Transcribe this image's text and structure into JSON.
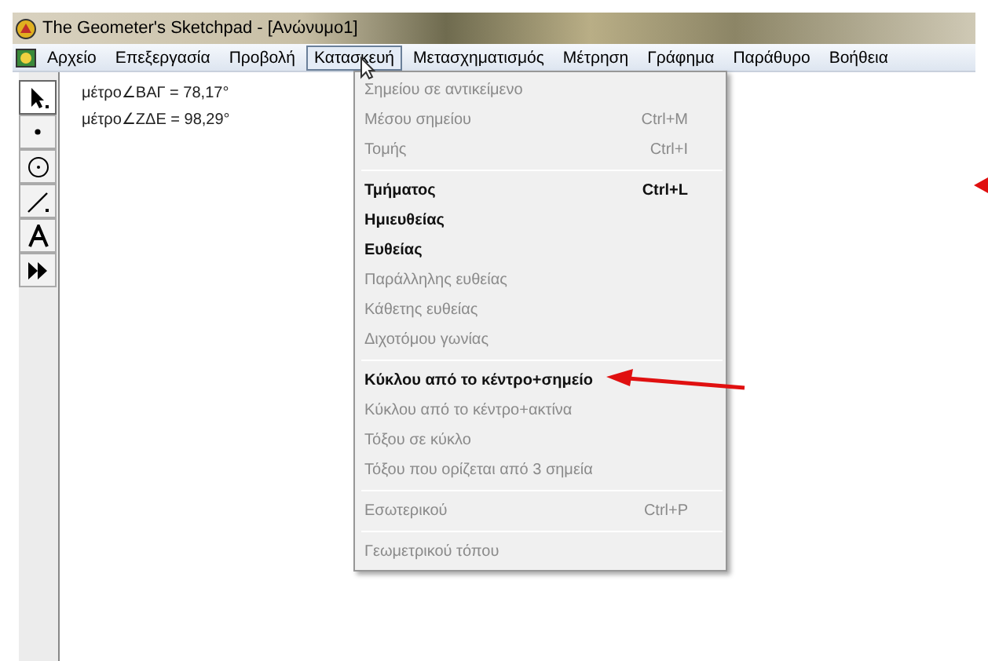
{
  "window": {
    "title": "The Geometer's Sketchpad - [Ανώνυμο1]"
  },
  "menu_bar": [
    {
      "label": "Αρχείο",
      "selected": false
    },
    {
      "label": "Επεξεργασία",
      "selected": false
    },
    {
      "label": "Προβολή",
      "selected": false
    },
    {
      "label": "Κατασκευή",
      "selected": true
    },
    {
      "label": "Μετασχηματισμός",
      "selected": false
    },
    {
      "label": "Μέτρηση",
      "selected": false
    },
    {
      "label": "Γράφημα",
      "selected": false
    },
    {
      "label": "Παράθυρο",
      "selected": false
    },
    {
      "label": "Βοήθεια",
      "selected": false
    }
  ],
  "toolbox": [
    {
      "kind": "arrow",
      "selected": true
    },
    {
      "kind": "point",
      "selected": false
    },
    {
      "kind": "compass",
      "selected": false
    },
    {
      "kind": "straightedge",
      "selected": false
    },
    {
      "kind": "text",
      "selected": false
    },
    {
      "kind": "custom",
      "selected": false
    }
  ],
  "measurements": [
    "μέτρο∠ΒΑΓ = 78,17°",
    "μέτρο∠ΖΔΕ = 98,29°"
  ],
  "dropdown": [
    {
      "kind": "item",
      "label": "Σημείου σε αντικείμενο",
      "disabled": true
    },
    {
      "kind": "item",
      "label": "Μέσου σημείου",
      "shortcut": "Ctrl+M",
      "disabled": true
    },
    {
      "kind": "item",
      "label": "Τομής",
      "shortcut": "Ctrl+I",
      "disabled": true
    },
    {
      "kind": "separator"
    },
    {
      "kind": "item",
      "label": "Τμήματος",
      "shortcut": "Ctrl+L",
      "disabled": false
    },
    {
      "kind": "item",
      "label": "Ημιευθείας",
      "disabled": false
    },
    {
      "kind": "item",
      "label": "Ευθείας",
      "disabled": false
    },
    {
      "kind": "item",
      "label": "Παράλληλης ευθείας",
      "disabled": true
    },
    {
      "kind": "item",
      "label": "Κάθετης ευθείας",
      "disabled": true
    },
    {
      "kind": "item",
      "label": "Διχοτόμου γωνίας",
      "disabled": true
    },
    {
      "kind": "separator"
    },
    {
      "kind": "item",
      "label": "Κύκλου από το κέντρο+σημείο",
      "disabled": false
    },
    {
      "kind": "item",
      "label": "Κύκλου από το κέντρο+ακτίνα",
      "disabled": true
    },
    {
      "kind": "item",
      "label": "Τόξου σε κύκλο",
      "disabled": true
    },
    {
      "kind": "item",
      "label": "Τόξου που ορίζεται από 3 σημεία",
      "disabled": true
    },
    {
      "kind": "separator"
    },
    {
      "kind": "item",
      "label": "Εσωτερικού",
      "shortcut": "Ctrl+P",
      "disabled": true
    },
    {
      "kind": "separator"
    },
    {
      "kind": "item",
      "label": "Γεωμετρικού τόπου",
      "disabled": true
    }
  ]
}
